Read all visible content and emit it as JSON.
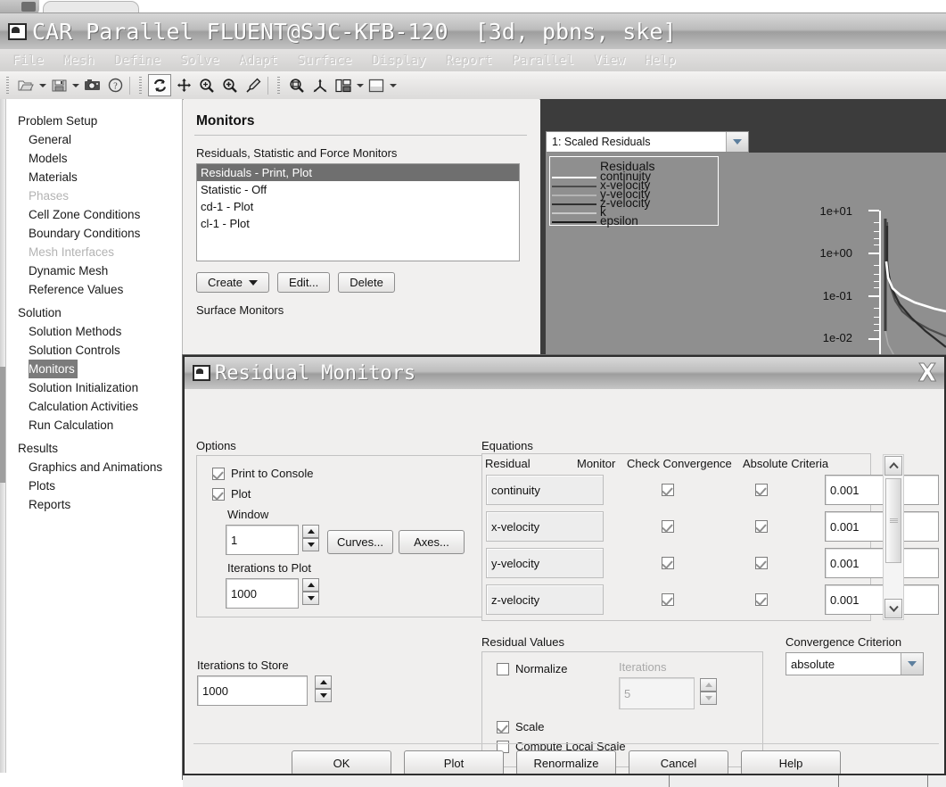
{
  "window": {
    "title": "CAR Parallel FLUENT@SJC-KFB-120  [3d, pbns, ske]",
    "icon": "fluent-app-icon"
  },
  "menubar": {
    "items": [
      "File",
      "Mesh",
      "Define",
      "Solve",
      "Adapt",
      "Surface",
      "Display",
      "Report",
      "Parallel",
      "View",
      "Help"
    ]
  },
  "toolbar": {
    "groups": [
      [
        "open-file-icon",
        "open-file-dropdown",
        "save-file-icon",
        "save-file-dropdown",
        "camera-icon",
        "help-icon"
      ],
      [
        "rotate-icon",
        "pan-icon",
        "zoom-region-icon",
        "zoom-in-icon",
        "probe-icon"
      ],
      [
        "fit-to-window-icon",
        "axes-icon",
        "panels-icon",
        "panels-dropdown",
        "background-icon",
        "background-dropdown"
      ]
    ]
  },
  "sidebar": {
    "sections": [
      {
        "title": "Problem Setup",
        "items": [
          {
            "label": "General",
            "state": "normal"
          },
          {
            "label": "Models",
            "state": "normal"
          },
          {
            "label": "Materials",
            "state": "normal"
          },
          {
            "label": "Phases",
            "state": "disabled"
          },
          {
            "label": "Cell Zone Conditions",
            "state": "normal"
          },
          {
            "label": "Boundary Conditions",
            "state": "normal"
          },
          {
            "label": "Mesh Interfaces",
            "state": "disabled"
          },
          {
            "label": "Dynamic Mesh",
            "state": "normal"
          },
          {
            "label": "Reference Values",
            "state": "normal"
          }
        ]
      },
      {
        "title": "Solution",
        "items": [
          {
            "label": "Solution Methods",
            "state": "normal"
          },
          {
            "label": "Solution Controls",
            "state": "normal"
          },
          {
            "label": "Monitors",
            "state": "selected"
          },
          {
            "label": "Solution Initialization",
            "state": "normal"
          },
          {
            "label": "Calculation Activities",
            "state": "normal"
          },
          {
            "label": "Run Calculation",
            "state": "normal"
          }
        ]
      },
      {
        "title": "Results",
        "items": [
          {
            "label": "Graphics and Animations",
            "state": "normal"
          },
          {
            "label": "Plots",
            "state": "normal"
          },
          {
            "label": "Reports",
            "state": "normal"
          }
        ]
      }
    ]
  },
  "monitors_panel": {
    "title": "Monitors",
    "list_label": "Residuals, Statistic and Force Monitors",
    "list_items": [
      {
        "label": "Residuals - Print, Plot",
        "selected": true
      },
      {
        "label": "Statistic - Off",
        "selected": false
      },
      {
        "label": "cd-1 - Plot",
        "selected": false
      },
      {
        "label": "cl-1 - Plot",
        "selected": false
      }
    ],
    "buttons": {
      "create": "Create",
      "edit": "Edit...",
      "delete": "Delete"
    },
    "surface_label": "Surface Monitors"
  },
  "graphics": {
    "combo_value": "1: Scaled Residuals"
  },
  "chart_data": {
    "type": "line",
    "title": "Residuals",
    "xlabel": "",
    "ylabel": "",
    "yscale": "log",
    "yticks": [
      "1e+01",
      "1e+00",
      "1e-01",
      "1e-02"
    ],
    "ylim": [
      0.01,
      10
    ],
    "grid": false,
    "legend_position": "top-left",
    "series": [
      {
        "name": "continuity",
        "color": "#ffffff",
        "values": [
          5.0,
          0.3,
          0.12,
          0.085,
          0.07,
          0.06,
          0.052,
          0.046,
          0.041,
          0.037,
          0.034,
          0.031,
          0.029,
          0.027,
          0.025,
          0.023
        ]
      },
      {
        "name": "x-velocity",
        "color": "#4c4c4c",
        "values": [
          4.6,
          0.22,
          0.055,
          0.03,
          0.02,
          0.015,
          0.012,
          0.0098,
          0.0082,
          0.007,
          0.006,
          0.0052,
          0.0046,
          0.0041,
          0.0037,
          0.0033
        ]
      },
      {
        "name": "y-velocity",
        "color": "#b4b4b4",
        "values": [
          4.2,
          0.2,
          0.05,
          0.028,
          0.019,
          0.014,
          0.011,
          0.009,
          0.0076,
          0.0065,
          0.0056,
          0.0049,
          0.0043,
          0.0038,
          0.0034,
          0.0031
        ]
      },
      {
        "name": "z-velocity",
        "color": "#303030",
        "values": [
          4.0,
          0.19,
          0.048,
          0.027,
          0.018,
          0.013,
          0.0105,
          0.0086,
          0.0072,
          0.0062,
          0.0053,
          0.0046,
          0.0041,
          0.0036,
          0.0032,
          0.0029
        ]
      },
      {
        "name": "k",
        "color": "#c8c8c8",
        "values": [
          3.5,
          0.16,
          0.042,
          0.024,
          0.016,
          0.012,
          0.0095,
          0.0078,
          0.0066,
          0.0056,
          0.0048,
          0.0042,
          0.0037,
          0.0033,
          0.0029,
          0.0026
        ]
      },
      {
        "name": "epsilon",
        "color": "#1a1a1a",
        "values": [
          3.2,
          0.15,
          0.04,
          0.022,
          0.015,
          0.011,
          0.0088,
          0.0072,
          0.0061,
          0.0052,
          0.0045,
          0.0039,
          0.0034,
          0.003,
          0.0027,
          0.0024
        ]
      }
    ]
  },
  "dialog": {
    "title": "Residual Monitors",
    "close_icon": "close-icon",
    "options": {
      "label": "Options",
      "print_to_console": {
        "label": "Print to Console",
        "checked": true
      },
      "plot": {
        "label": "Plot",
        "checked": true
      },
      "window": {
        "label": "Window",
        "value": "1"
      },
      "iterations_to_plot": {
        "label": "Iterations to Plot",
        "value": "1000"
      },
      "curves_button": "Curves...",
      "axes_button": "Axes..."
    },
    "iterations_to_store": {
      "label": "Iterations to Store",
      "value": "1000"
    },
    "equations": {
      "label": "Equations",
      "columns": [
        "Residual",
        "Monitor",
        "Check Convergence",
        "Absolute Criteria"
      ],
      "rows": [
        {
          "residual": "continuity",
          "monitor": true,
          "check_convergence": true,
          "absolute_criteria": "0.001"
        },
        {
          "residual": "x-velocity",
          "monitor": true,
          "check_convergence": true,
          "absolute_criteria": "0.001"
        },
        {
          "residual": "y-velocity",
          "monitor": true,
          "check_convergence": true,
          "absolute_criteria": "0.001"
        },
        {
          "residual": "z-velocity",
          "monitor": true,
          "check_convergence": true,
          "absolute_criteria": "0.001"
        }
      ]
    },
    "residual_values": {
      "label": "Residual Values",
      "normalize": {
        "label": "Normalize",
        "checked": false
      },
      "iterations": {
        "label": "Iterations",
        "value": "5",
        "disabled": true
      },
      "scale": {
        "label": "Scale",
        "checked": true
      },
      "compute_local_scale": {
        "label": "Compute Local Scale",
        "checked": false
      }
    },
    "convergence_criterion": {
      "label": "Convergence Criterion",
      "value": "absolute"
    },
    "buttons": [
      "OK",
      "Plot",
      "Renormalize",
      "Cancel",
      "Help"
    ]
  }
}
